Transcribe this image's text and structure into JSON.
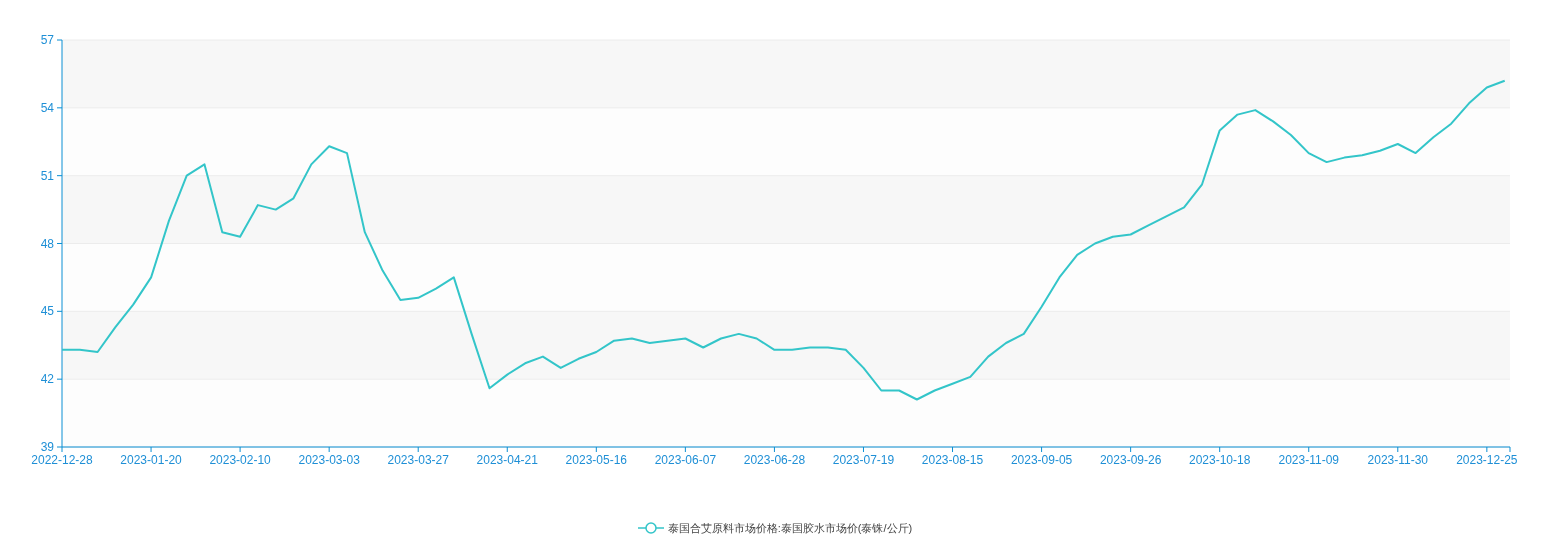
{
  "chart": {
    "chart_data": {
      "type": "line",
      "categories": [
        "2022-12-28",
        null,
        null,
        null,
        null,
        "2023-01-20",
        null,
        null,
        null,
        null,
        "2023-02-10",
        null,
        null,
        null,
        null,
        "2023-03-03",
        null,
        null,
        null,
        null,
        "2023-03-27",
        null,
        null,
        null,
        null,
        "2023-04-21",
        null,
        null,
        null,
        null,
        "2023-05-16",
        null,
        null,
        null,
        null,
        "2023-06-07",
        null,
        null,
        null,
        null,
        "2023-06-28",
        null,
        null,
        null,
        null,
        "2023-07-19",
        null,
        null,
        null,
        null,
        "2023-08-15",
        null,
        null,
        null,
        null,
        "2023-09-05",
        null,
        null,
        null,
        null,
        "2023-09-26",
        null,
        null,
        null,
        null,
        "2023-10-18",
        null,
        null,
        null,
        null,
        "2023-11-09",
        null,
        null,
        null,
        null,
        "2023-11-30",
        null,
        null,
        null,
        null,
        "2023-12-25",
        null
      ],
      "ylim": [
        39,
        57
      ],
      "grid": true,
      "yticks": [
        39,
        42,
        45,
        48,
        51,
        54,
        57
      ],
      "series": [
        {
          "name": "泰国合艾原料市场价格:泰国胶水市场价(泰铢/公斤)",
          "color": "#33c5c9",
          "values": [
            43.3,
            43.3,
            43.2,
            44.3,
            45.3,
            46.5,
            49.0,
            51.0,
            51.5,
            48.5,
            48.3,
            49.7,
            49.5,
            50.0,
            51.5,
            52.3,
            52.0,
            48.5,
            46.8,
            45.5,
            45.6,
            46.0,
            46.5,
            44.0,
            41.6,
            42.2,
            42.7,
            43.0,
            42.5,
            42.9,
            43.2,
            43.7,
            43.8,
            43.6,
            43.7,
            43.8,
            43.4,
            43.8,
            44.0,
            43.8,
            43.3,
            43.3,
            43.4,
            43.4,
            43.3,
            42.5,
            41.5,
            41.5,
            41.1,
            41.5,
            41.8,
            42.1,
            43.0,
            43.6,
            44.0,
            45.2,
            46.5,
            47.5,
            48.0,
            48.3,
            48.4,
            48.8,
            49.2,
            49.6,
            50.6,
            53.0,
            53.7,
            53.9,
            53.4,
            52.8,
            52.0,
            51.6,
            51.8,
            51.9,
            52.1,
            52.4,
            52.0,
            52.7,
            53.3,
            54.2,
            54.9,
            55.2
          ]
        }
      ]
    }
  }
}
